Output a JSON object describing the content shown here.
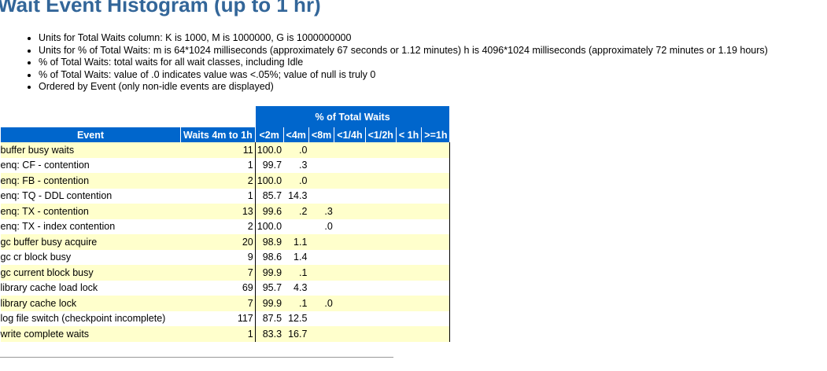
{
  "title": "Wait Event Histogram (up to 1 hr)",
  "notes": [
    "Units for Total Waits column: K is 1000, M is 1000000, G is 1000000000",
    "Units for % of Total Waits: m is 64*1024 milliseconds (approximately 67 seconds or 1.12 minutes) h is 4096*1024 milliseconds (approximately 72 minutes or 1.19 hours)",
    "% of Total Waits: total waits for all wait classes, including Idle",
    "% of Total Waits: value of .0 indicates value was <.05%; value of null is truly 0",
    "Ordered by Event (only non-idle events are displayed)"
  ],
  "table": {
    "group_header": "% of Total Waits",
    "columns": [
      "Event",
      "Waits 4m to 1h",
      "<2m",
      "<4m",
      "<8m",
      "<1/4h",
      "<1/2h",
      "< 1h",
      ">=1h"
    ],
    "rows": [
      [
        "buffer busy waits",
        "11",
        "100.0",
        ".0",
        "",
        "",
        "",
        "",
        ""
      ],
      [
        "enq: CF - contention",
        "1",
        "99.7",
        ".3",
        "",
        "",
        "",
        "",
        ""
      ],
      [
        "enq: FB - contention",
        "2",
        "100.0",
        ".0",
        "",
        "",
        "",
        "",
        ""
      ],
      [
        "enq: TQ - DDL contention",
        "1",
        "85.7",
        "14.3",
        "",
        "",
        "",
        "",
        ""
      ],
      [
        "enq: TX - contention",
        "13",
        "99.6",
        ".2",
        ".3",
        "",
        "",
        "",
        ""
      ],
      [
        "enq: TX - index contention",
        "2",
        "100.0",
        "",
        ".0",
        "",
        "",
        "",
        ""
      ],
      [
        "gc buffer busy acquire",
        "20",
        "98.9",
        "1.1",
        "",
        "",
        "",
        "",
        ""
      ],
      [
        "gc cr block busy",
        "9",
        "98.6",
        "1.4",
        "",
        "",
        "",
        "",
        ""
      ],
      [
        "gc current block busy",
        "7",
        "99.9",
        ".1",
        "",
        "",
        "",
        "",
        ""
      ],
      [
        "library cache load lock",
        "69",
        "95.7",
        "4.3",
        "",
        "",
        "",
        "",
        ""
      ],
      [
        "library cache lock",
        "7",
        "99.9",
        ".1",
        ".0",
        "",
        "",
        "",
        ""
      ],
      [
        "log file switch (checkpoint incomplete)",
        "117",
        "87.5",
        "12.5",
        "",
        "",
        "",
        "",
        ""
      ],
      [
        "write complete waits",
        "1",
        "83.3",
        "16.7",
        "",
        "",
        "",
        "",
        ""
      ]
    ]
  }
}
